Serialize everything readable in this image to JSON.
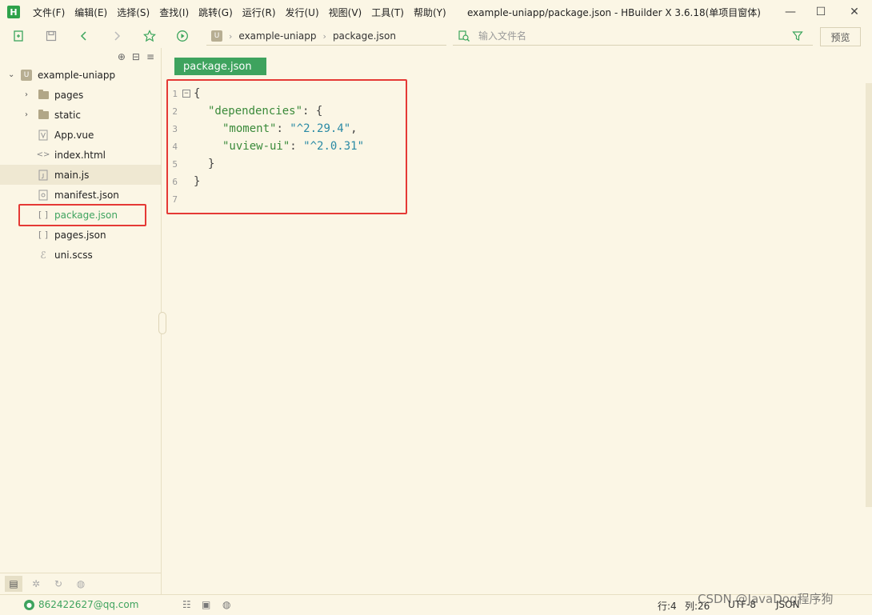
{
  "app": {
    "logo": "H",
    "window_title": "example-uniapp/package.json - HBuilder X 3.6.18(单项目窗体)"
  },
  "menu": [
    "文件(F)",
    "编辑(E)",
    "选择(S)",
    "查找(I)",
    "跳转(G)",
    "运行(R)",
    "发行(U)",
    "视图(V)",
    "工具(T)",
    "帮助(Y)"
  ],
  "breadcrumb": {
    "badge": "U",
    "project": "example-uniapp",
    "file": "package.json"
  },
  "search": {
    "placeholder": "输入文件名",
    "value": ""
  },
  "toolbar": {
    "preview_label": "预览"
  },
  "sidebar": {
    "project": "example-uniapp",
    "items": [
      {
        "label": "pages",
        "type": "folder",
        "icon": "folder-icon"
      },
      {
        "label": "static",
        "type": "folder",
        "icon": "folder-icon"
      },
      {
        "label": "App.vue",
        "type": "file",
        "icon": "vue-file-icon"
      },
      {
        "label": "index.html",
        "type": "file",
        "icon": "html-file-icon"
      },
      {
        "label": "main.js",
        "type": "file",
        "icon": "js-file-icon"
      },
      {
        "label": "manifest.json",
        "type": "file",
        "icon": "manifest-file-icon"
      },
      {
        "label": "package.json",
        "type": "file",
        "icon": "json-file-icon"
      },
      {
        "label": "pages.json",
        "type": "file",
        "icon": "json-file-icon"
      },
      {
        "label": "uni.scss",
        "type": "file",
        "icon": "scss-file-icon"
      }
    ]
  },
  "editor": {
    "tab_label": "package.json",
    "lines": [
      {
        "no": "1",
        "fold": "⊟"
      },
      {
        "no": "2"
      },
      {
        "no": "3"
      },
      {
        "no": "4"
      },
      {
        "no": "5"
      },
      {
        "no": "6"
      },
      {
        "no": "7"
      }
    ],
    "code": {
      "l1": "{",
      "l2_key": "\"dependencies\"",
      "l2_rest": ": {",
      "l3_key": "\"moment\"",
      "l3_colon": ": ",
      "l3_val": "\"^2.29.4\"",
      "l3_comma": ",",
      "l4_key": "\"uview-ui\"",
      "l4_colon": ": ",
      "l4_val": "\"^2.0.31\"",
      "l5": "}",
      "l6": "}"
    }
  },
  "status": {
    "user": "862422627@qq.com",
    "line": "行:4",
    "col": "列:26",
    "encoding": "UTF-8",
    "language": "JSON"
  },
  "watermark": "CSDN @JavaDog程序狗",
  "colors": {
    "accent": "#3ea35e",
    "highlight": "#e53935",
    "background": "#fbf6e5"
  }
}
